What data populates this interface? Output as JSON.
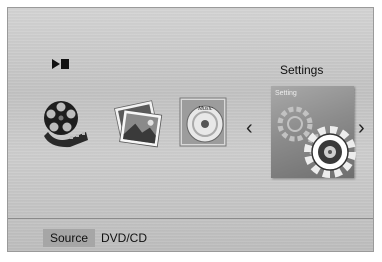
{
  "screen": {
    "title": "Settings",
    "status_icon": "play-pause-icon"
  },
  "menu": {
    "items": [
      {
        "id": "movie",
        "icon": "film-reel-icon"
      },
      {
        "id": "photo",
        "icon": "photo-stack-icon"
      },
      {
        "id": "music",
        "icon": "music-disc-icon",
        "disc_text": "Music"
      },
      {
        "id": "settings",
        "icon": "settings-gear-icon",
        "card_label": "Setting",
        "selected": true
      }
    ],
    "prev_glyph": "‹",
    "next_glyph": "›"
  },
  "bottom_bar": {
    "source_label": "Source",
    "source_value": "DVD/CD"
  }
}
